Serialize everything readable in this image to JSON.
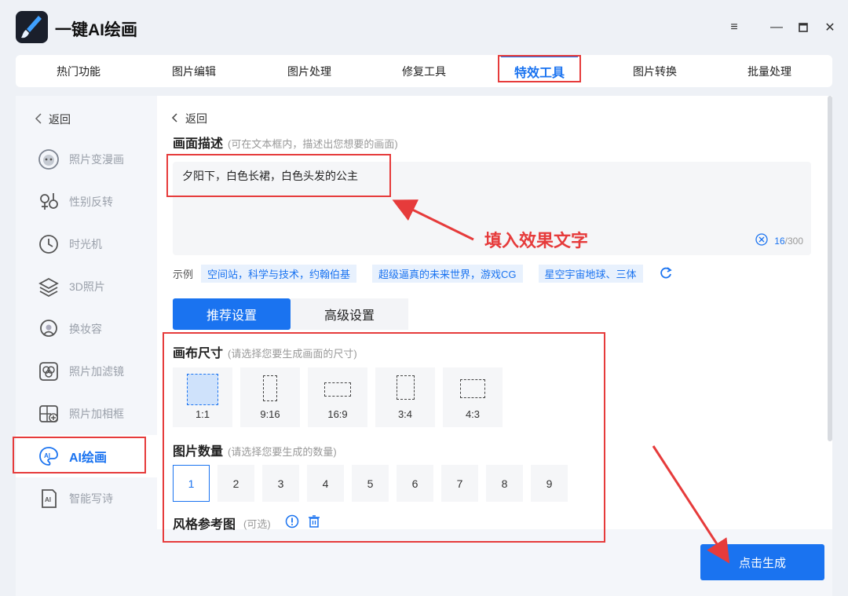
{
  "app": {
    "title": "一键AI绘画"
  },
  "tabs": [
    {
      "label": "热门功能"
    },
    {
      "label": "图片编辑"
    },
    {
      "label": "图片处理"
    },
    {
      "label": "修复工具"
    },
    {
      "label": "特效工具"
    },
    {
      "label": "图片转换"
    },
    {
      "label": "批量处理"
    }
  ],
  "active_tab": "特效工具",
  "sidebar": {
    "back_label": "返回",
    "items": [
      {
        "label": "照片变漫画",
        "icon": "cartoon-face-icon"
      },
      {
        "label": "性别反转",
        "icon": "gender-icon"
      },
      {
        "label": "时光机",
        "icon": "clock-icon"
      },
      {
        "label": "3D照片",
        "icon": "layers-icon"
      },
      {
        "label": "换妆容",
        "icon": "makeup-icon"
      },
      {
        "label": "照片加滤镜",
        "icon": "filter-icon"
      },
      {
        "label": "照片加相框",
        "icon": "frame-icon"
      },
      {
        "label": "AI绘画",
        "icon": "ai-paint-icon"
      },
      {
        "label": "智能写诗",
        "icon": "ai-poem-icon"
      }
    ],
    "active": "AI绘画"
  },
  "main": {
    "back_label": "返回",
    "description": {
      "title": "画面描述",
      "hint": "(可在文本框内，描述出您想要的画面)",
      "value": "夕阳下，白色长裙，白色头发的公主",
      "count": "16",
      "max": "/300"
    },
    "annotation": "填入效果文字",
    "examples": {
      "label": "示例",
      "items": [
        "空间站，科学与技术，约翰伯基",
        "超级逼真的未来世界，游戏CG",
        "星空宇宙地球、三体"
      ]
    },
    "setting_tabs": [
      "推荐设置",
      "高级设置"
    ],
    "canvas_size": {
      "title": "画布尺寸",
      "hint": "(请选择您要生成画面的尺寸)",
      "options": [
        "1:1",
        "9:16",
        "16:9",
        "3:4",
        "4:3"
      ],
      "selected": "1:1"
    },
    "image_count": {
      "title": "图片数量",
      "hint": "(请选择您要生成的数量)",
      "options": [
        "1",
        "2",
        "3",
        "4",
        "5",
        "6",
        "7",
        "8",
        "9"
      ],
      "selected": "1"
    },
    "style_ref": {
      "title": "风格参考图",
      "hint": "(可选)"
    },
    "generate_label": "点击生成"
  },
  "colors": {
    "accent": "#1a73f0",
    "annotation": "#e63b3b"
  }
}
